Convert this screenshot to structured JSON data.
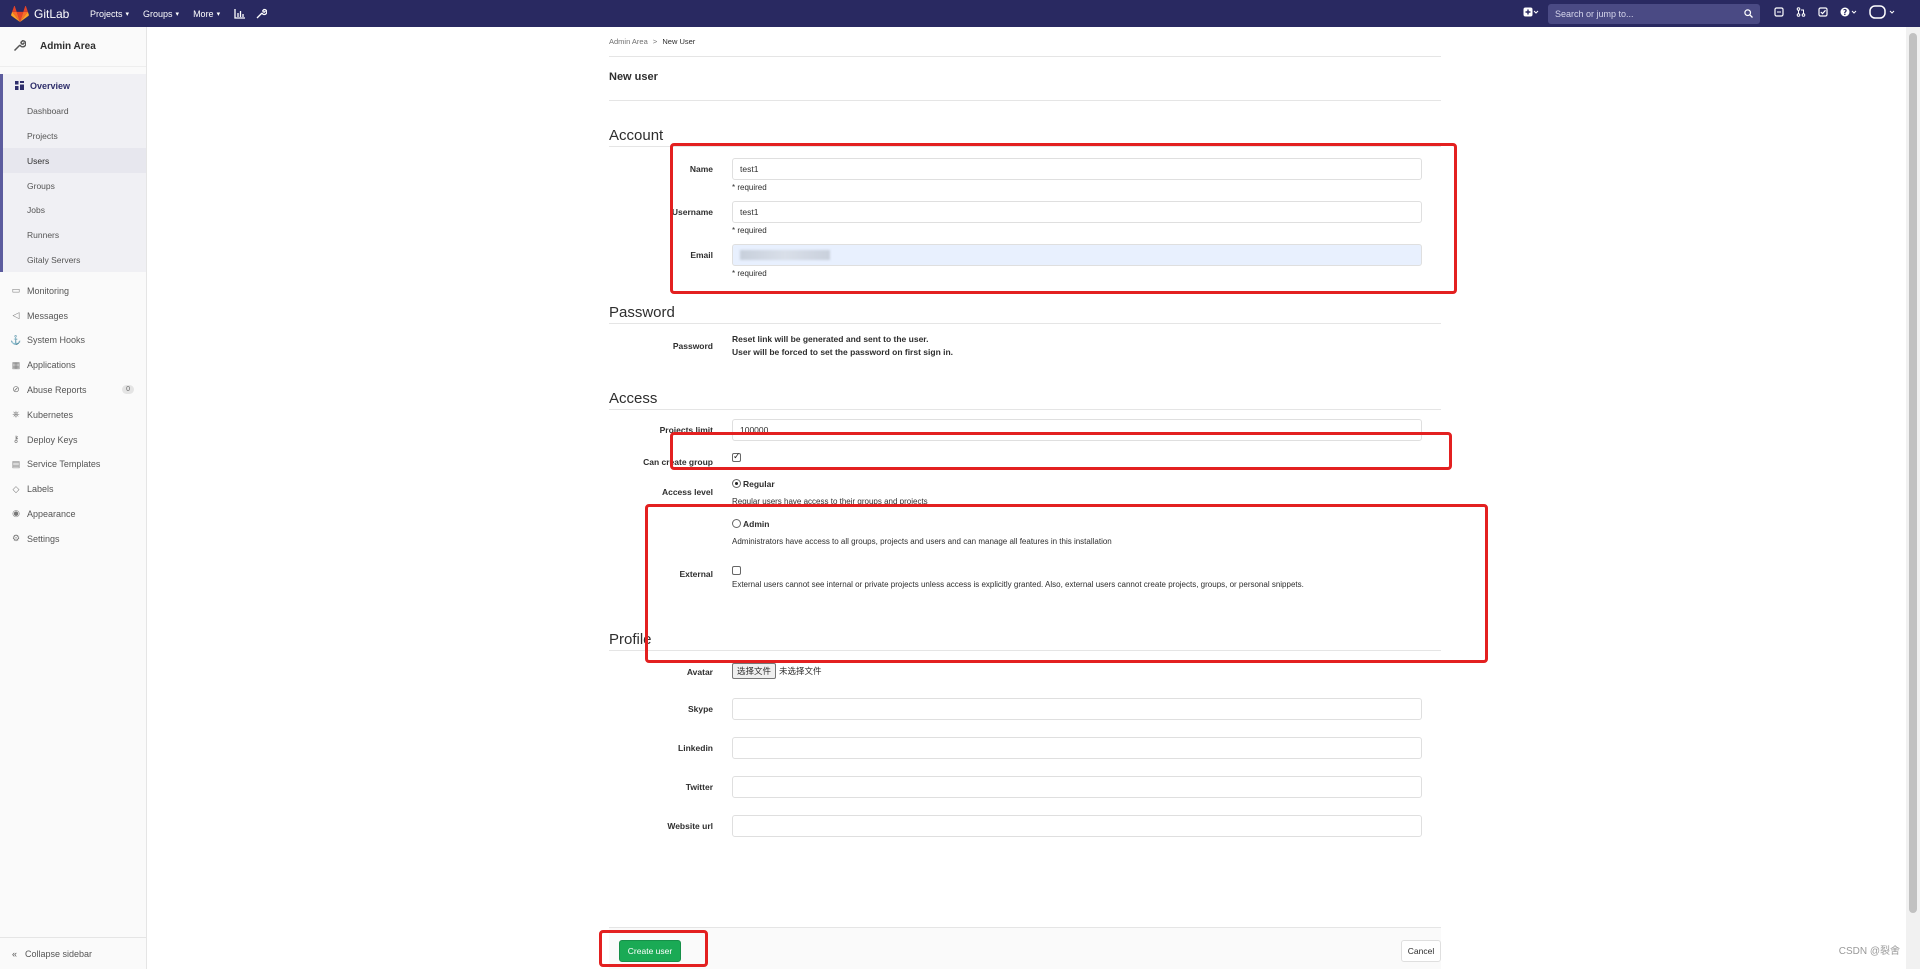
{
  "navbar": {
    "brand": "GitLab",
    "links": [
      "Projects",
      "Groups",
      "More"
    ],
    "search_placeholder": "Search or jump to...",
    "icons": [
      "activity-chart-icon",
      "admin-wrench-icon",
      "plus-icon",
      "issues-icon",
      "merge-requests-icon",
      "todos-icon",
      "help-icon",
      "user-avatar-icon"
    ]
  },
  "sidebar": {
    "title": "Admin Area",
    "overview": "Overview",
    "overview_items": [
      "Dashboard",
      "Projects",
      "Users",
      "Groups",
      "Jobs",
      "Runners",
      "Gitaly Servers"
    ],
    "items": [
      {
        "label": "Monitoring",
        "icon": "monitor-icon"
      },
      {
        "label": "Messages",
        "icon": "megaphone-icon"
      },
      {
        "label": "System Hooks",
        "icon": "hook-icon"
      },
      {
        "label": "Applications",
        "icon": "apps-icon"
      },
      {
        "label": "Abuse Reports",
        "icon": "abuse-icon",
        "badge": "0"
      },
      {
        "label": "Kubernetes",
        "icon": "kubernetes-icon"
      },
      {
        "label": "Deploy Keys",
        "icon": "key-icon"
      },
      {
        "label": "Service Templates",
        "icon": "template-icon"
      },
      {
        "label": "Labels",
        "icon": "label-icon"
      },
      {
        "label": "Appearance",
        "icon": "appearance-icon"
      },
      {
        "label": "Settings",
        "icon": "gear-icon"
      }
    ],
    "collapse": "Collapse sidebar"
  },
  "breadcrumb": {
    "parent": "Admin Area",
    "separator": ">",
    "current": "New User"
  },
  "page_title": "New user",
  "account": {
    "heading": "Account",
    "name_label": "Name",
    "name_value": "test1",
    "username_label": "Username",
    "username_value": "test1",
    "email_label": "Email",
    "required": "* required"
  },
  "password": {
    "heading": "Password",
    "label": "Password",
    "line1": "Reset link will be generated and sent to the user.",
    "line2": "User will be forced to set the password on first sign in."
  },
  "access": {
    "heading": "Access",
    "projects_limit_label": "Projects limit",
    "projects_limit_value": "100000",
    "can_create_group_label": "Can create group",
    "can_create_group_checked": true,
    "access_level_label": "Access level",
    "regular_label": "Regular",
    "regular_desc": "Regular users have access to their groups and projects",
    "admin_label": "Admin",
    "admin_desc": "Administrators have access to all groups, projects and users and can manage all features in this installation",
    "selected_level": "Regular",
    "external_label": "External",
    "external_checked": false,
    "external_desc": "External users cannot see internal or private projects unless access is explicitly granted. Also, external users cannot create projects, groups, or personal snippets."
  },
  "profile": {
    "heading": "Profile",
    "avatar_label": "Avatar",
    "file_button": "选择文件",
    "file_status": "未选择文件",
    "skype_label": "Skype",
    "linkedin_label": "Linkedin",
    "twitter_label": "Twitter",
    "website_label": "Website url"
  },
  "actions": {
    "create": "Create user",
    "cancel": "Cancel"
  },
  "watermark": "CSDN @裂舍",
  "colors": {
    "navbar": "#292961",
    "primary_button": "#1aaa55",
    "highlight_box": "#e32020"
  }
}
